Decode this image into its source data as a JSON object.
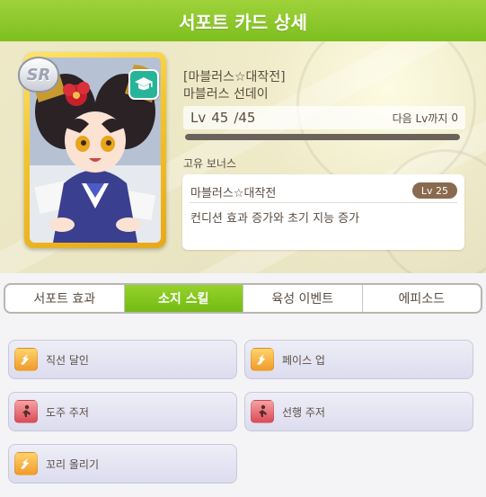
{
  "header": {
    "title": "서포트 카드 상세"
  },
  "card": {
    "rarity": "SR",
    "type_icon": "graduation-cap-icon",
    "series": "[마블러스☆대작전]",
    "name": "마블러스 선데이",
    "level_prefix": "Lv",
    "level": "45",
    "level_max": "/45",
    "next_label": "다음 Lv까지",
    "next_value": "0",
    "level_progress": 1.0
  },
  "unique_bonus": {
    "section_label": "고유 보너스",
    "name": "마블러스☆대작전",
    "level_badge": "Lv 25",
    "description": "컨디션 효과 증가와 초기 지능 증가"
  },
  "tabs": [
    {
      "label": "서포트 효과",
      "active": false
    },
    {
      "label": "소지 스킬",
      "active": true
    },
    {
      "label": "육성 이벤트",
      "active": false
    },
    {
      "label": "에피소드",
      "active": false
    }
  ],
  "skills": [
    {
      "label": "직선 달인",
      "icon": "speed-up-icon",
      "icon_color": "#f29a2b"
    },
    {
      "label": "페이스 업",
      "icon": "speed-up-icon",
      "icon_color": "#f29a2b"
    },
    {
      "label": "도주 주저",
      "icon": "debuff-runner-icon",
      "icon_color": "#d94c58"
    },
    {
      "label": "선행 주저",
      "icon": "debuff-runner-icon",
      "icon_color": "#d94c58"
    },
    {
      "label": "꼬리 올리기",
      "icon": "speed-up-icon",
      "icon_color": "#f29a2b"
    }
  ],
  "colors": {
    "header": "#8cca2a",
    "active_tab": "#82c41e",
    "text": "#5a4c42",
    "level_badge": "#8a6a4e"
  }
}
